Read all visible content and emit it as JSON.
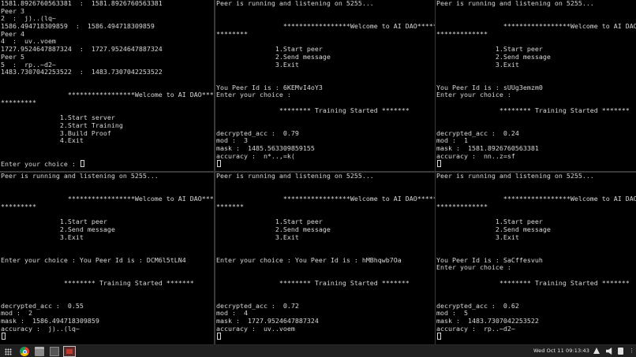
{
  "panes": [
    {
      "id": "pane-server",
      "lines": [
        "1581.8926760563381  :  1581.8926760563381",
        "Peer 3",
        "2  :  j)..(lq~",
        "1586.494718309859  :  1586.494718309859",
        "Peer 4",
        "4  :  uv..voem",
        "1727.9524647887324  :  1727.9524647887324",
        "Peer 5",
        "5  :  rp..~d2~",
        "1483.7307042253522  :  1483.7307042253522",
        "",
        "",
        "                 *****************Welcome to AI DAO*********",
        "*********",
        "",
        "               1.Start server",
        "               2.Start Training",
        "               3.Build Proof",
        "               4.Exit",
        "",
        "",
        "Enter your choice : "
      ]
    },
    {
      "id": "pane-peer-top-middle",
      "lines": [
        "Peer is running and listening on 5255...",
        "",
        "",
        "                 *****************Welcome to AI DAO*********",
        "********",
        "",
        "               1.Start peer",
        "               2.Send message",
        "               3.Exit",
        "",
        "",
        "You Peer Id is : 6KEMvI4oY3",
        "Enter your choice :",
        "",
        "                ******** Training Started *******",
        "",
        "",
        "decrypted_acc :  0.79",
        "mod :  3",
        "mask :  1485.563309859155",
        "accuracy :  n*..,=k(",
        ""
      ]
    },
    {
      "id": "pane-peer-top-right",
      "lines": [
        "Peer is running and listening on 5255...",
        "",
        "",
        "                 *****************Welcome to AI DAO*********",
        "*************",
        "",
        "               1.Start peer",
        "               2.Send message",
        "               3.Exit",
        "",
        "",
        "You Peer Id is : sUUg3emzm0",
        "Enter your choice :",
        "",
        "                ******** Training Started *******",
        "",
        "",
        "decrypted_acc :  0.24",
        "mod :  1",
        "mask :  1581.8926760563381",
        "accuracy :  nn..z=sf",
        ""
      ]
    },
    {
      "id": "pane-peer-bottom-left",
      "lines": [
        "Peer is running and listening on 5255...",
        "",
        "",
        "                 *****************Welcome to AI DAO*********",
        "*********",
        "",
        "               1.Start peer",
        "               2.Send message",
        "               3.Exit",
        "",
        "",
        "Enter your choice : You Peer Id is : DCM6l5tLN4",
        "",
        "",
        "                ******** Training Started *******",
        "",
        "",
        "decrypted_acc :  0.55",
        "mod :  2",
        "mask :  1586.494718309859",
        "accuracy :  j)..(lq~",
        ""
      ]
    },
    {
      "id": "pane-peer-bottom-middle",
      "lines": [
        "Peer is running and listening on 5255...",
        "",
        "",
        "                 *****************Welcome to AI DAO*********",
        "*******",
        "",
        "               1.Start peer",
        "               2.Send message",
        "               3.Exit",
        "",
        "",
        "Enter your choice : You Peer Id is : hMBhqwb7Oa",
        "",
        "",
        "                ******** Training Started *******",
        "",
        "",
        "decrypted_acc :  0.72",
        "mod :  4",
        "mask :  1727.9524647887324",
        "accuracy :  uv..voem",
        ""
      ]
    },
    {
      "id": "pane-peer-bottom-right",
      "lines": [
        "Peer is running and listening on 5255...",
        "",
        "",
        "                 *****************Welcome to AI DAO*********",
        "*************",
        "",
        "               1.Start peer",
        "               2.Send message",
        "               3.Exit",
        "",
        "",
        "You Peer Id is : SaCffesvuh",
        "Enter your choice :",
        "",
        "                ******** Training Started *******",
        "",
        "",
        "decrypted_acc :  0.62",
        "mod :  5",
        "mask :  1483.7307042253522",
        "accuracy :  rp..~d2~",
        ""
      ]
    }
  ],
  "taskbar": {
    "clock": "Wed Oct 11  09:13:43",
    "apps": [
      "apps-grid-icon",
      "chrome-icon",
      "files-icon",
      "terminal-icon",
      "active-terminal-icon"
    ],
    "tray": [
      "network-icon",
      "volume-icon",
      "battery-icon",
      "menu-icon"
    ],
    "menu_glyph": "⋮"
  }
}
